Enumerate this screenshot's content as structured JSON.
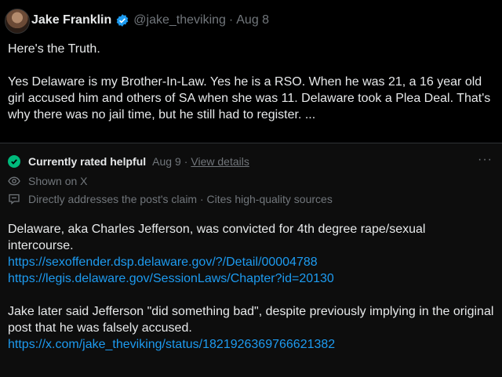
{
  "post": {
    "author_name": "Jake Franklin",
    "handle": "@jake_theviking",
    "separator": "·",
    "date": "Aug 8",
    "paragraphs": [
      "Here's the Truth.",
      "Yes Delaware is my Brother-In-Law. Yes he is a RSO. When he was 21, a 16 year old girl accused him and others of SA when she was 11. Delaware took a Plea Deal. That's why there was no jail time, but he still had to register. ..."
    ]
  },
  "note": {
    "status": "Currently rated helpful",
    "date": "Aug 9",
    "separator": "·",
    "view_details": "View details",
    "more": "···",
    "shown_on": "Shown on X",
    "reasons": "Directly addresses the post's claim · Cites high-quality sources",
    "body_1": "Delaware, aka Charles Jefferson, was convicted for 4th degree rape/sexual intercourse.",
    "link_1": "https://sexoffender.dsp.delaware.gov/?/Detail/00004788",
    "link_2": "https://legis.delaware.gov/SessionLaws/Chapter?id=20130",
    "body_2": "Jake later said Jefferson \"did something bad\", despite previously implying in the original post that he was falsely accused.",
    "link_3": "https://x.com/jake_theviking/status/1821926369766621382"
  },
  "colors": {
    "background": "#000000",
    "text": "#e7e9ea",
    "muted": "#71767b",
    "link": "#1d9bf0",
    "verified": "#1d9bf0",
    "helpful": "#00ba7c"
  }
}
